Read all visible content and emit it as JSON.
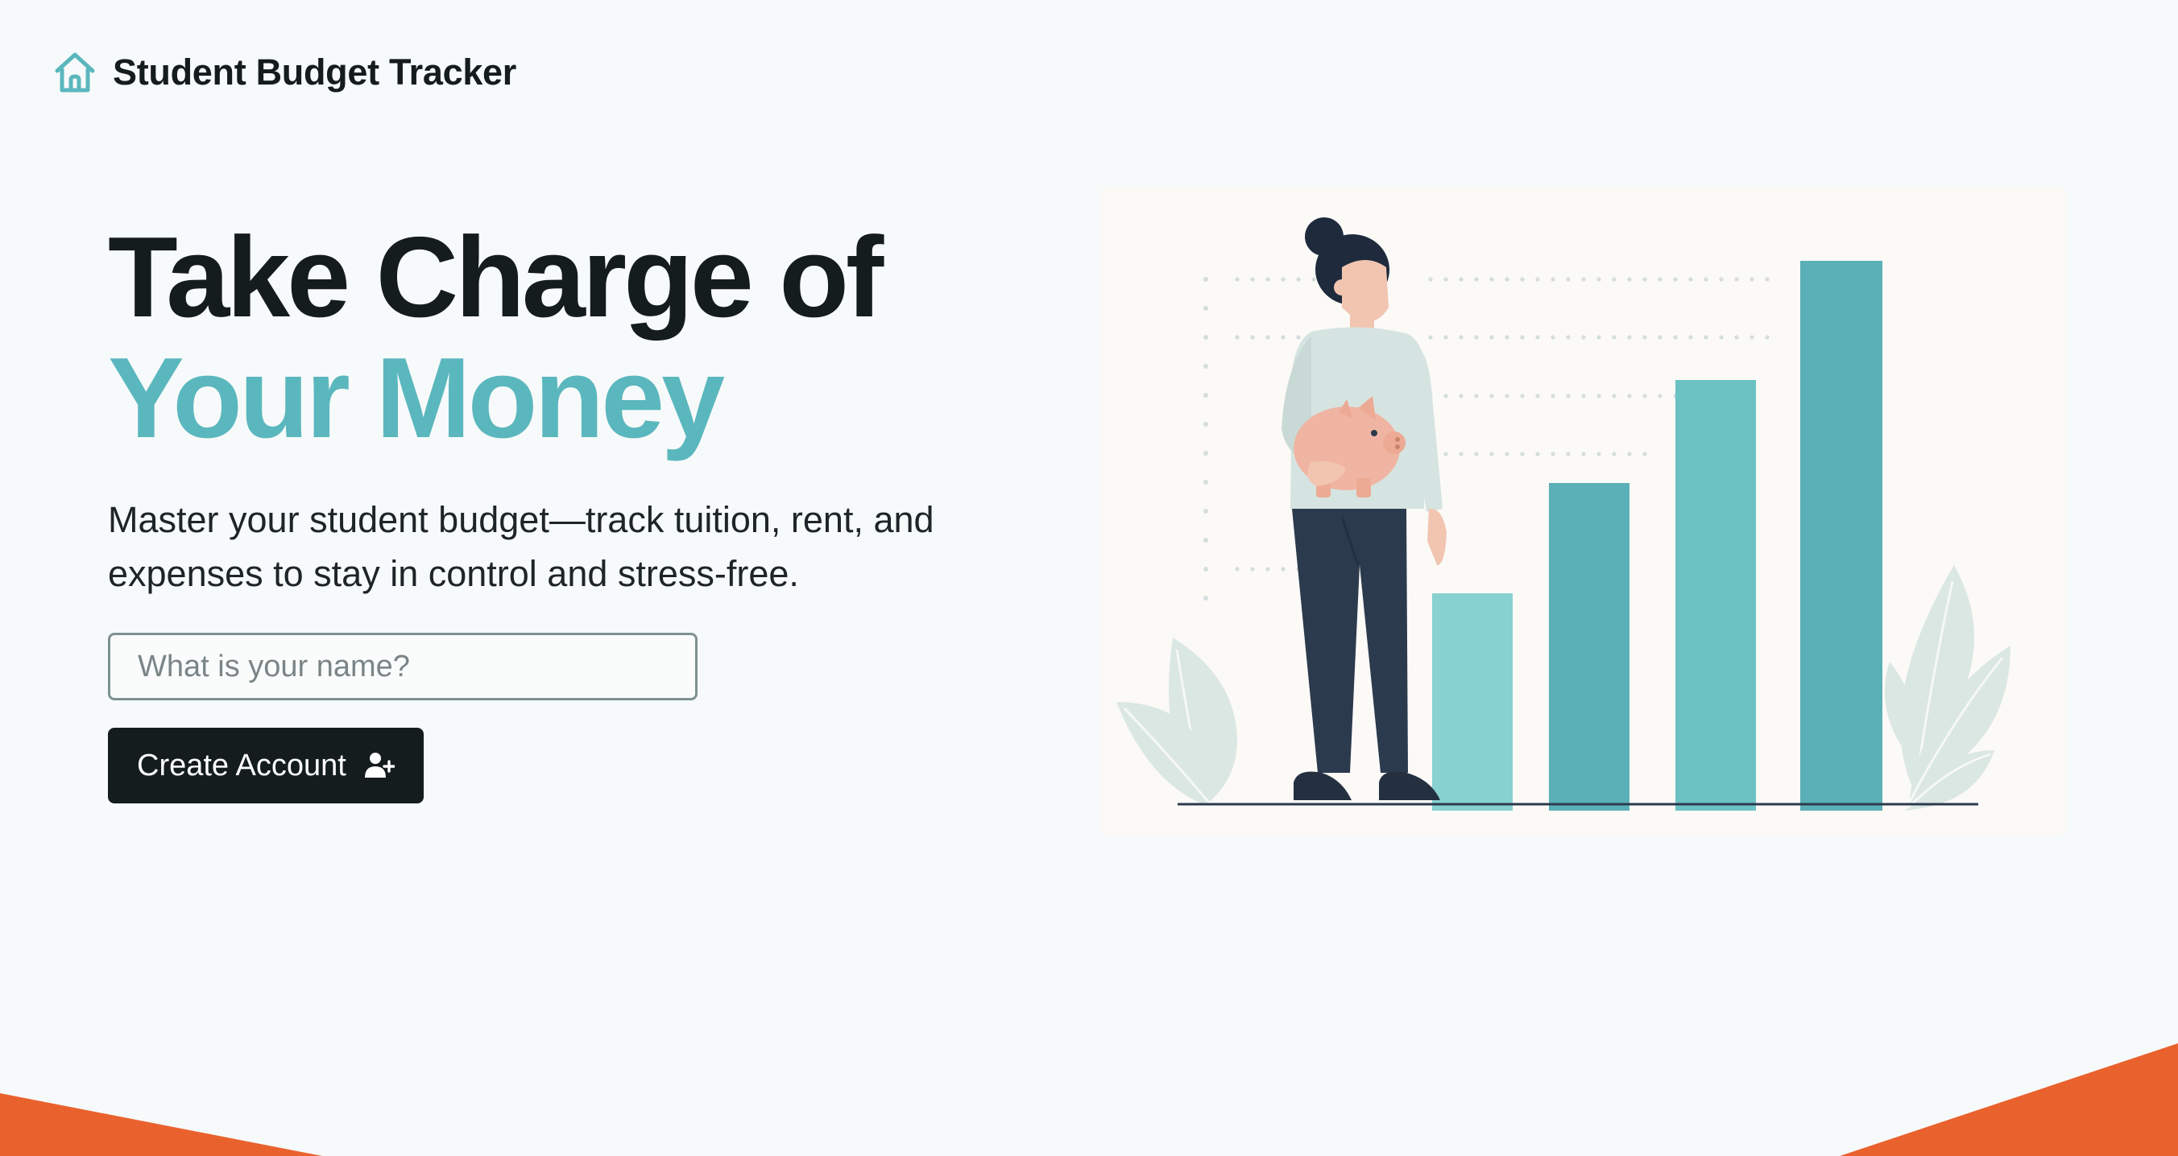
{
  "header": {
    "logo_icon": "home-icon",
    "title": "Student Budget Tracker"
  },
  "hero": {
    "headline_line1": "Take Charge of",
    "headline_line2": "Your Money",
    "subtitle": "Master your student budget—track tuition, rent, and expenses to stay in control and stress-free.",
    "name_input": {
      "placeholder": "What is your name?",
      "value": ""
    },
    "create_button": {
      "label": "Create Account",
      "icon": "user-plus-icon"
    }
  },
  "illustration": {
    "description_icons": [
      "person-icon",
      "piggy-bank-icon",
      "bar-growth-icon",
      "leaf-icon"
    ]
  },
  "colors": {
    "accent": "#5bb7be",
    "dark": "#151c1e",
    "background": "#f7fafa",
    "corner": "#e9622e",
    "bar_light": "#87d2d0",
    "bar_dark": "#5ab0b6",
    "piggy": "#f0b5a2",
    "navy": "#2c3a4e"
  }
}
